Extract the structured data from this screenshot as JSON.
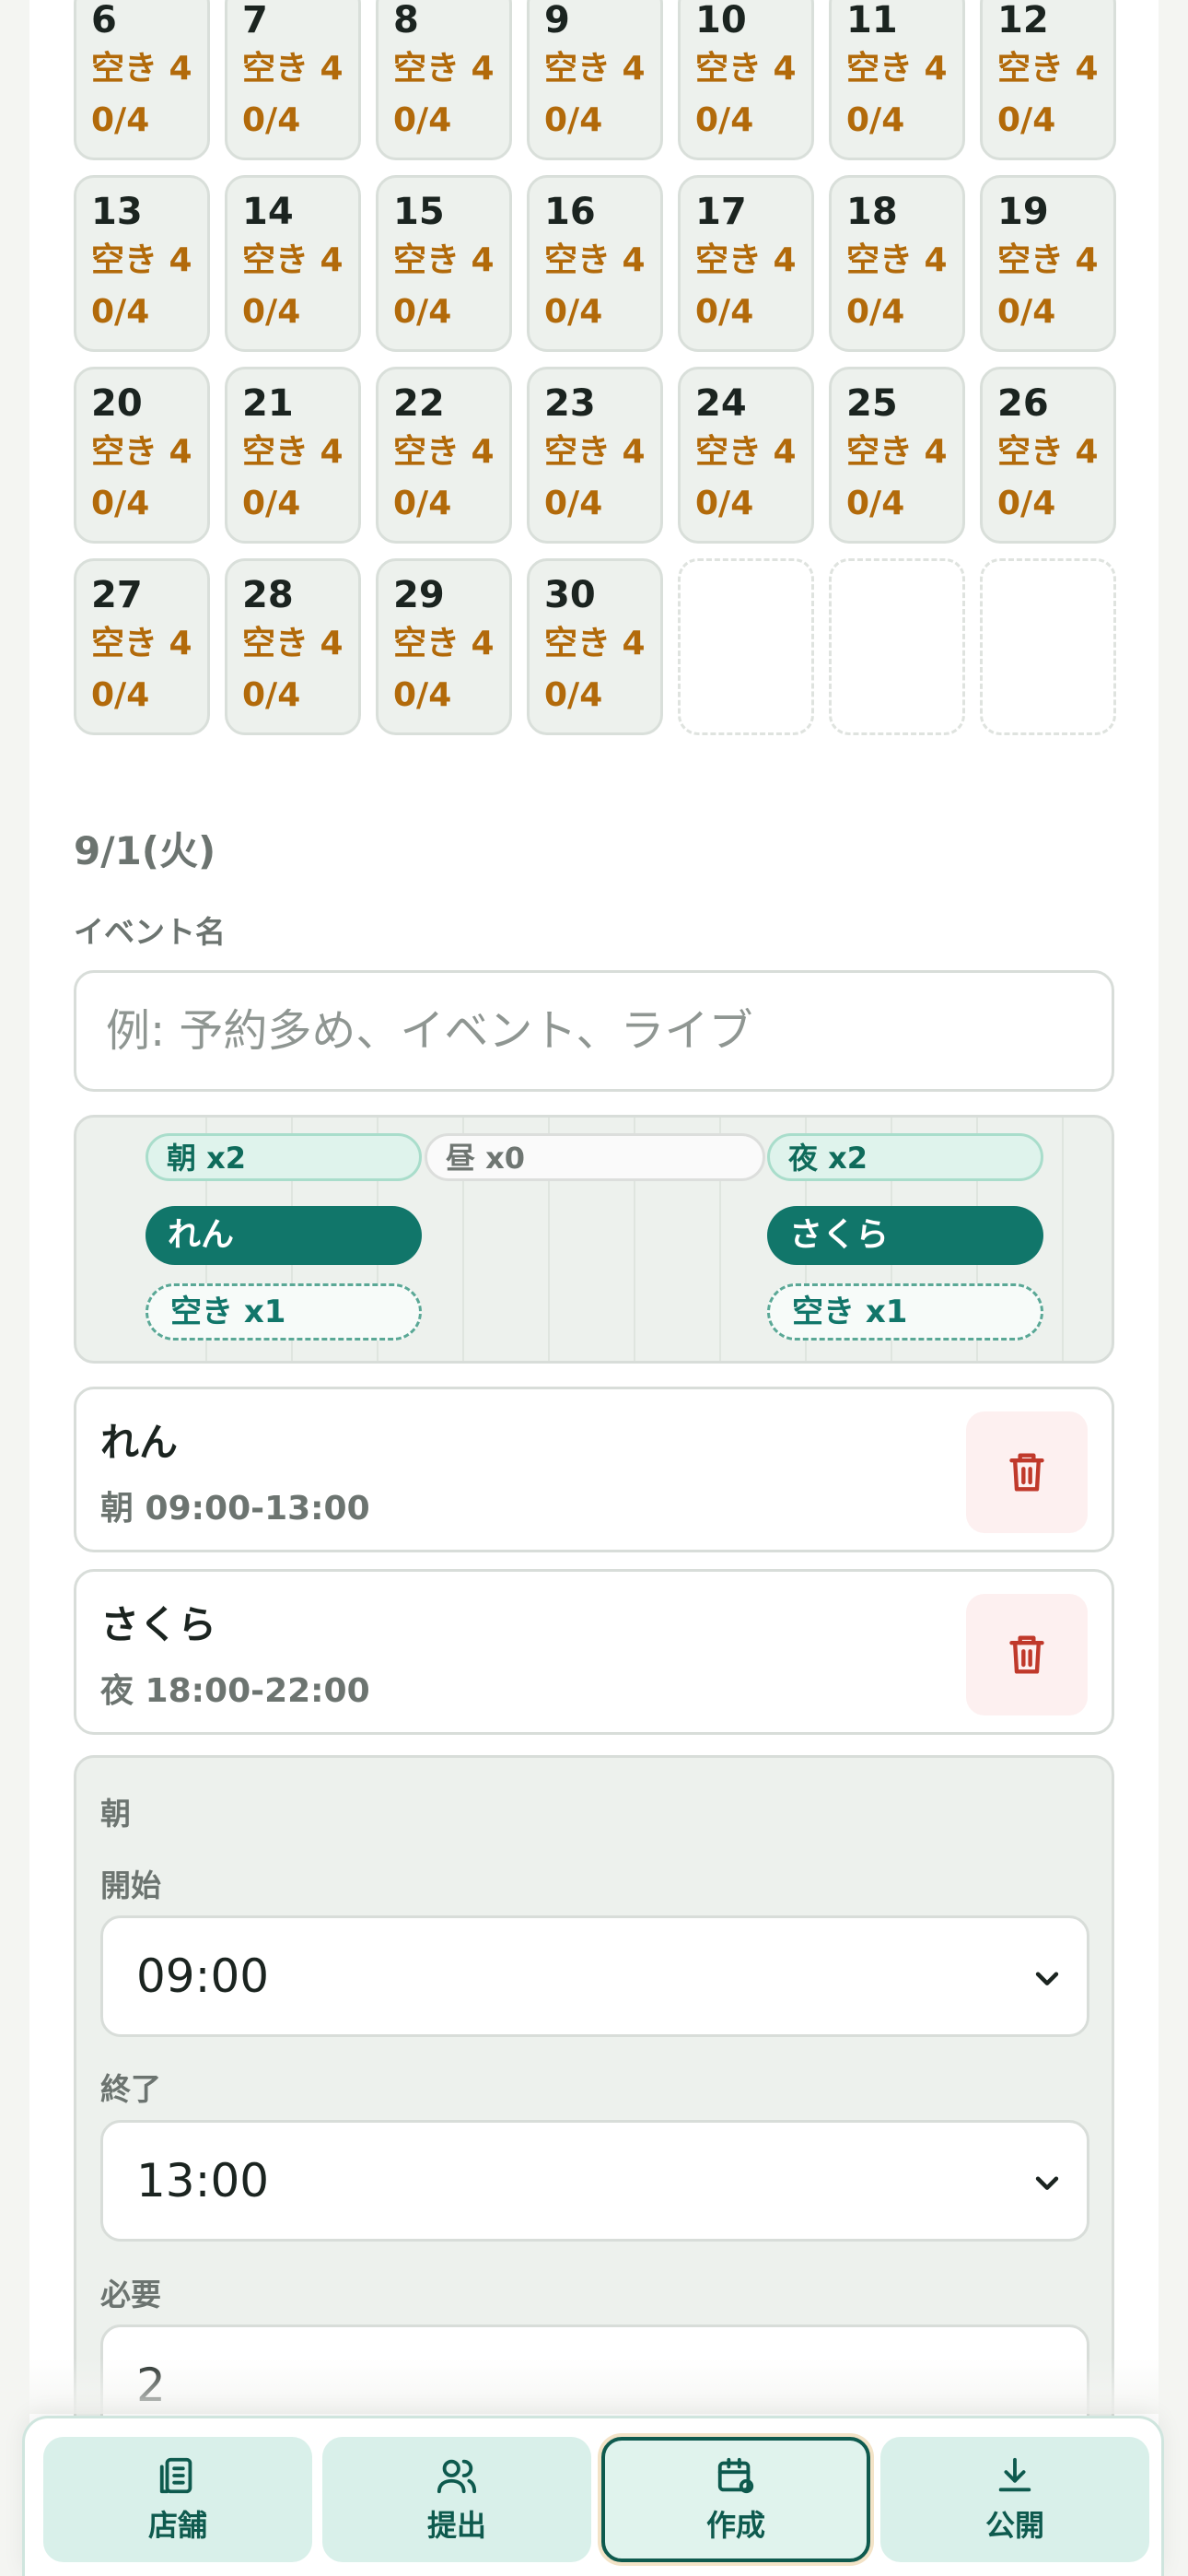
{
  "calendar": {
    "days": [
      {
        "num": "6",
        "avail": "空き 4",
        "ratio": "0/4"
      },
      {
        "num": "7",
        "avail": "空き 4",
        "ratio": "0/4"
      },
      {
        "num": "8",
        "avail": "空き 4",
        "ratio": "0/4"
      },
      {
        "num": "9",
        "avail": "空き 4",
        "ratio": "0/4"
      },
      {
        "num": "10",
        "avail": "空き 4",
        "ratio": "0/4"
      },
      {
        "num": "11",
        "avail": "空き 4",
        "ratio": "0/4"
      },
      {
        "num": "12",
        "avail": "空き 4",
        "ratio": "0/4"
      },
      {
        "num": "13",
        "avail": "空き 4",
        "ratio": "0/4"
      },
      {
        "num": "14",
        "avail": "空き 4",
        "ratio": "0/4"
      },
      {
        "num": "15",
        "avail": "空き 4",
        "ratio": "0/4"
      },
      {
        "num": "16",
        "avail": "空き 4",
        "ratio": "0/4"
      },
      {
        "num": "17",
        "avail": "空き 4",
        "ratio": "0/4"
      },
      {
        "num": "18",
        "avail": "空き 4",
        "ratio": "0/4"
      },
      {
        "num": "19",
        "avail": "空き 4",
        "ratio": "0/4"
      },
      {
        "num": "20",
        "avail": "空き 4",
        "ratio": "0/4"
      },
      {
        "num": "21",
        "avail": "空き 4",
        "ratio": "0/4"
      },
      {
        "num": "22",
        "avail": "空き 4",
        "ratio": "0/4"
      },
      {
        "num": "23",
        "avail": "空き 4",
        "ratio": "0/4"
      },
      {
        "num": "24",
        "avail": "空き 4",
        "ratio": "0/4"
      },
      {
        "num": "25",
        "avail": "空き 4",
        "ratio": "0/4"
      },
      {
        "num": "26",
        "avail": "空き 4",
        "ratio": "0/4"
      },
      {
        "num": "27",
        "avail": "空き 4",
        "ratio": "0/4"
      },
      {
        "num": "28",
        "avail": "空き 4",
        "ratio": "0/4"
      },
      {
        "num": "29",
        "avail": "空き 4",
        "ratio": "0/4"
      },
      {
        "num": "30",
        "avail": "空き 4",
        "ratio": "0/4"
      }
    ]
  },
  "selected_date": "9/1(火)",
  "event_name": {
    "label": "イベント名",
    "placeholder": "例: 予約多め、イベント、ライブ",
    "value": ""
  },
  "timeline": {
    "slots": [
      {
        "label": "朝 x2"
      },
      {
        "label": "昼 x0"
      },
      {
        "label": "夜 x2"
      }
    ],
    "assignments": [
      {
        "name": "れん"
      },
      {
        "name": "さくら"
      }
    ],
    "vacancies": [
      {
        "label": "空き x1"
      },
      {
        "label": "空き x1"
      }
    ]
  },
  "shifts": [
    {
      "name": "れん",
      "time": "朝 09:00-13:00",
      "delete_icon": "trash-icon"
    },
    {
      "name": "さくら",
      "time": "夜 18:00-22:00",
      "delete_icon": "trash-icon"
    }
  ],
  "editor": {
    "section": "朝",
    "start_label": "開始",
    "start_value": "09:00",
    "end_label": "終了",
    "end_value": "13:00",
    "required_label": "必要",
    "required_value": "2"
  },
  "nav": {
    "items": [
      {
        "label": "店舗",
        "icon": "store-icon"
      },
      {
        "label": "提出",
        "icon": "users-icon"
      },
      {
        "label": "作成",
        "icon": "calendar-settings-icon"
      },
      {
        "label": "公開",
        "icon": "download-icon"
      }
    ],
    "active": "作成"
  },
  "colors": {
    "accent": "#11766a",
    "warning_text": "#b26a0a",
    "danger": "#c0392b"
  }
}
